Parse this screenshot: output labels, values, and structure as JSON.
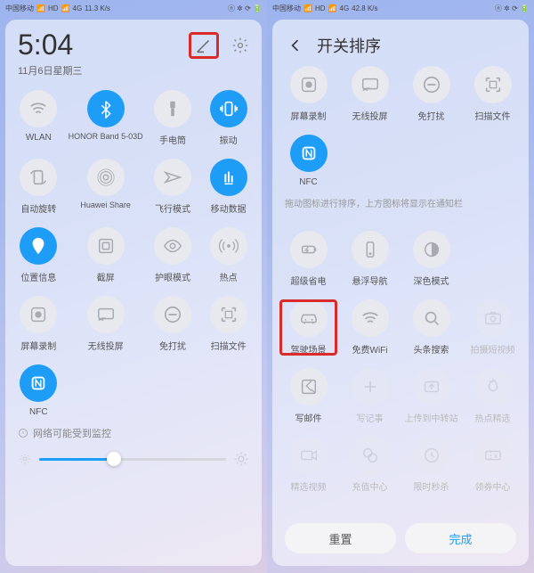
{
  "left": {
    "status": {
      "carrier": "中国移动",
      "net1": "HD",
      "sig": "4G",
      "speed": "11.3 K/s",
      "icons": "ⓝ ✲ ⟳ 🔋"
    },
    "time": "5:04",
    "date": "11月6日星期三",
    "tiles": [
      {
        "label": "WLAN",
        "icon": "wifi",
        "on": false
      },
      {
        "label": "HONOR Band 5-03D",
        "icon": "bt",
        "on": true
      },
      {
        "label": "手电筒",
        "icon": "torch",
        "on": false
      },
      {
        "label": "振动",
        "icon": "vibrate",
        "on": true
      },
      {
        "label": "自动旋转",
        "icon": "rotate",
        "on": false
      },
      {
        "label": "Huawei Share",
        "icon": "share",
        "on": false
      },
      {
        "label": "飞行模式",
        "icon": "plane",
        "on": false
      },
      {
        "label": "移动数据",
        "icon": "data",
        "on": true
      },
      {
        "label": "位置信息",
        "icon": "pin",
        "on": true
      },
      {
        "label": "截屏",
        "icon": "shot",
        "on": false
      },
      {
        "label": "护眼模式",
        "icon": "eye",
        "on": false
      },
      {
        "label": "热点",
        "icon": "hotspot",
        "on": false
      },
      {
        "label": "屏幕录制",
        "icon": "rec",
        "on": false
      },
      {
        "label": "无线投屏",
        "icon": "cast",
        "on": false
      },
      {
        "label": "免打扰",
        "icon": "dnd",
        "on": false
      },
      {
        "label": "扫描文件",
        "icon": "scan",
        "on": false
      },
      {
        "label": "NFC",
        "icon": "nfc",
        "on": true
      }
    ],
    "netnote": "网络可能受到监控",
    "brightness_pct": 40
  },
  "right": {
    "status": {
      "carrier": "中国移动",
      "net1": "HD",
      "sig": "4G",
      "speed": "42.8 K/s",
      "icons": "ⓝ ✲ ⟳ 🔋"
    },
    "title": "开关排序",
    "row_top": [
      {
        "label": "屏幕录制",
        "icon": "rec"
      },
      {
        "label": "无线投屏",
        "icon": "cast"
      },
      {
        "label": "免打扰",
        "icon": "dnd"
      },
      {
        "label": "扫描文件",
        "icon": "scan"
      }
    ],
    "nfc": {
      "label": "NFC"
    },
    "hint": "拖动图标进行排序，上方图标将显示在通知栏",
    "row_a": [
      {
        "label": "超级省电",
        "icon": "bat"
      },
      {
        "label": "悬浮导航",
        "icon": "dock"
      },
      {
        "label": "深色模式",
        "icon": "dark"
      }
    ],
    "row_b": [
      {
        "label": "驾驶场景",
        "icon": "car",
        "hl": true
      },
      {
        "label": "免费WiFi",
        "icon": "wifi"
      },
      {
        "label": "头条搜索",
        "icon": "search"
      },
      {
        "label": "拍摄短视频",
        "icon": "cam",
        "dim": true
      }
    ],
    "row_c": [
      {
        "label": "写邮件",
        "icon": "mail"
      },
      {
        "label": "写记事",
        "icon": "plus",
        "dim": true
      },
      {
        "label": "上传到中转站",
        "icon": "upload",
        "dim": true
      },
      {
        "label": "热点精选",
        "icon": "flame",
        "dim": true
      }
    ],
    "row_d": [
      {
        "label": "精选视频",
        "icon": "video",
        "dim": true
      },
      {
        "label": "充值中心",
        "icon": "recharge",
        "dim": true
      },
      {
        "label": "限时秒杀",
        "icon": "clock",
        "dim": true
      },
      {
        "label": "领券中心",
        "icon": "ticket",
        "dim": true
      }
    ],
    "btn_reset": "重置",
    "btn_done": "完成"
  }
}
